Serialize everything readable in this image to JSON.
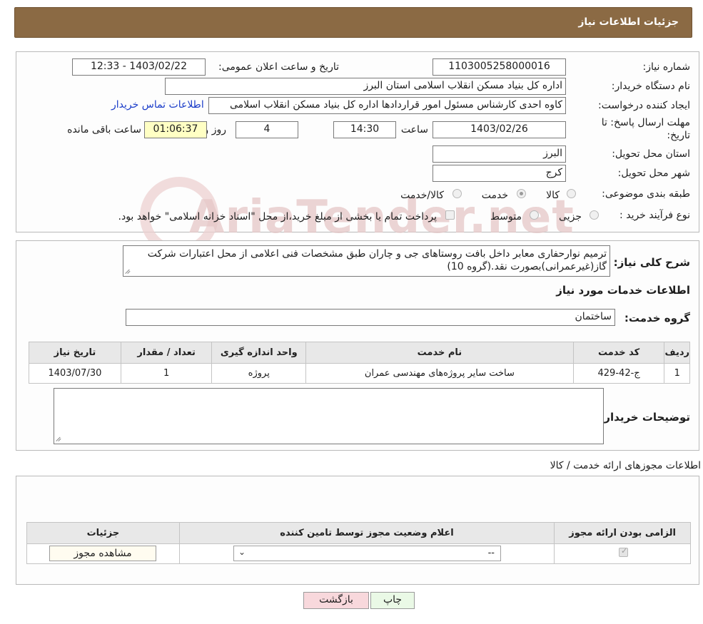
{
  "header": {
    "title": "جزئیات اطلاعات نیاز"
  },
  "form": {
    "need_number_label": "شماره نیاز:",
    "need_number": "1103005258000016",
    "announce_label": "تاریخ و ساعت اعلان عمومی:",
    "announce_value": "1403/02/22 - 12:33",
    "buyer_org_label": "نام دستگاه خریدار:",
    "buyer_org": "اداره کل بنیاد مسکن انقلاب اسلامی استان البرز",
    "creator_label": "ایجاد کننده درخواست:",
    "creator": "کاوه احدی کارشناس مسئول امور قراردادها اداره کل بنیاد مسکن انقلاب اسلامی",
    "contact_link": "اطلاعات تماس خریدار",
    "deadline_label_1": "مهلت ارسال پاسخ: تا",
    "deadline_label_2": "تاریخ:",
    "deadline_date": "1403/02/26",
    "time_label": "ساعت",
    "deadline_time": "14:30",
    "days_value": "4",
    "days_label": "روز و",
    "remaining_value": "01:06:37",
    "remaining_label": "ساعت باقی مانده",
    "province_label": "استان محل تحویل:",
    "province": "البرز",
    "city_label": "شهر محل تحویل:",
    "city": "کرج",
    "category_label": "طبقه بندی موضوعی:",
    "category_options": [
      "کالا",
      "خدمت",
      "کالا/خدمت"
    ],
    "purchase_type_label": "نوع فرآیند خرید :",
    "purchase_options": [
      "جزیی",
      "متوسط"
    ],
    "payment_note": "پرداخت تمام یا بخشی از مبلغ خرید،از محل \"اسناد خزانه اسلامی\" خواهد بود."
  },
  "summary": {
    "label": "شرح کلی نیاز:",
    "text": "ترمیم نوارحفاری معابر داخل بافت روستاهای جی و چاران طبق مشخصات فنی اعلامی از محل اعتبارات شرکت گاز(غیرعمرانی)بصورت نقد.(گروه 10)",
    "services_title": "اطلاعات خدمات مورد نیاز",
    "group_label": "گروه خدمت:",
    "group_value": "ساختمان"
  },
  "services_table": {
    "headers": [
      "ردیف",
      "کد خدمت",
      "نام خدمت",
      "واحد اندازه گیری",
      "تعداد / مقدار",
      "تاریخ نیاز"
    ],
    "rows": [
      {
        "idx": "1",
        "code": "ج-42-429",
        "name": "ساخت سایر پروژه‌های مهندسی عمران",
        "unit": "پروژه",
        "qty": "1",
        "date": "1403/07/30"
      }
    ]
  },
  "buyer_notes": {
    "label": "توضیحات خریدار:",
    "value": ""
  },
  "permits": {
    "title": "اطلاعات مجوزهای ارائه خدمت / کالا",
    "headers": [
      "الزامی بودن ارائه مجوز",
      "اعلام وضعیت مجوز توسط تامین کننده",
      "جزئیات"
    ],
    "select_value": "--",
    "view_button": "مشاهده مجوز"
  },
  "buttons": {
    "print": "چاپ",
    "back": "بازگشت"
  },
  "watermark": "AriaTender.net",
  "colors": {
    "header": "#8b6a44",
    "link": "#1a3cc9",
    "remaining_bg": "#ffffc4",
    "back_btn": "#f8d8dc",
    "print_btn": "#eaf9e6"
  }
}
